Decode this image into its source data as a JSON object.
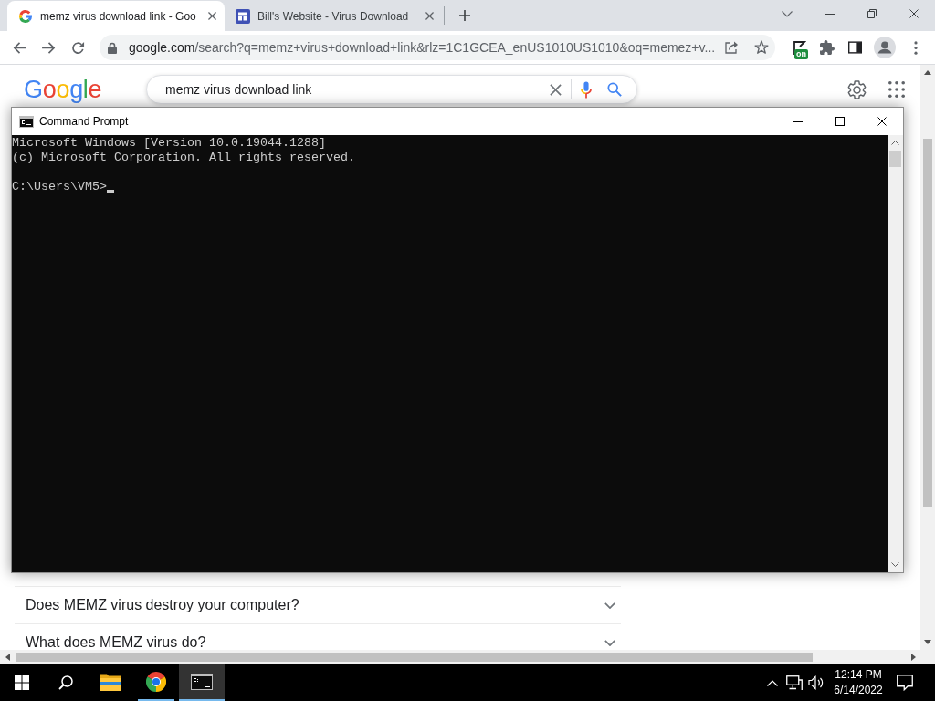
{
  "browser": {
    "tabs": [
      {
        "title": "memz virus download link - Goo",
        "kind": "google",
        "selected": true
      },
      {
        "title": "Bill's Website - Virus Download",
        "kind": "site",
        "selected": false
      }
    ],
    "toolbar": {
      "url": "google.com/search?q=memz+virus+download+link&rlz=1C1GCEA_enUS1010US1010&oq=memez+v...",
      "extension_badge": "on"
    },
    "page": {
      "logo": "Google",
      "search": {
        "value": "memz virus download link"
      },
      "questions": [
        {
          "text": "Does MEMZ virus destroy your computer?",
          "expanded": false
        },
        {
          "text": "What does MEMZ virus do?",
          "expanded": false
        }
      ]
    }
  },
  "command_prompt": {
    "title": "Command Prompt",
    "output": [
      "Microsoft Windows [Version 10.0.19044.1288]",
      "(c) Microsoft Corporation. All rights reserved."
    ],
    "prompt": "C:\\Users\\VM5>"
  },
  "taskbar": {
    "apps": [
      {
        "kind": "file-explorer",
        "running": false,
        "active": false
      },
      {
        "kind": "browser",
        "running": true,
        "active": false
      },
      {
        "kind": "terminal",
        "running": true,
        "active": true
      }
    ],
    "clock": {
      "time": "12:14 PM",
      "date": "6/14/2022"
    }
  }
}
